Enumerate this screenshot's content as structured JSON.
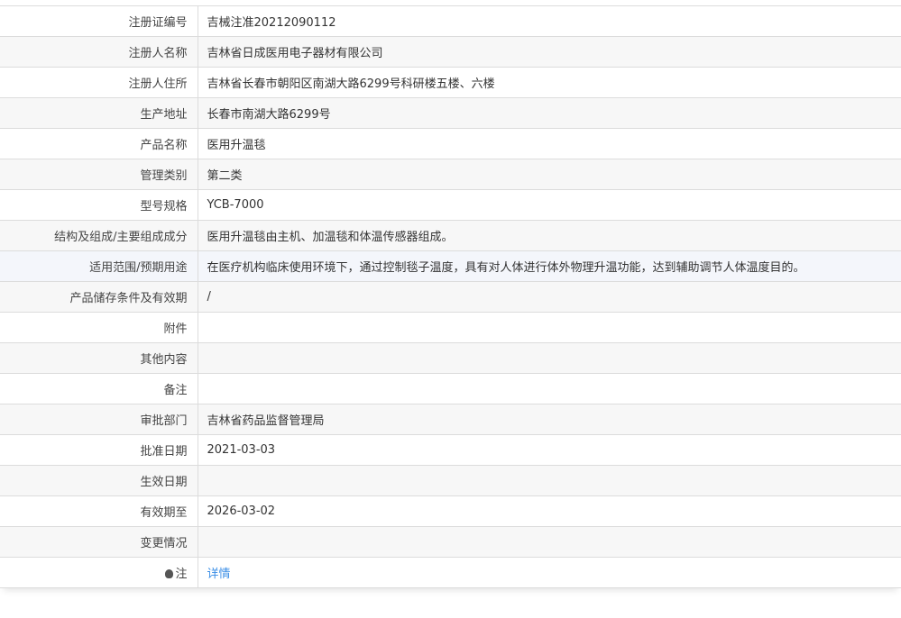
{
  "rows": [
    {
      "label": "注册证编号",
      "value": "吉械注准20212090112"
    },
    {
      "label": "注册人名称",
      "value": "吉林省日成医用电子器材有限公司"
    },
    {
      "label": "注册人住所",
      "value": "吉林省长春市朝阳区南湖大路6299号科研楼五楼、六楼"
    },
    {
      "label": "生产地址",
      "value": "长春市南湖大路6299号"
    },
    {
      "label": "产品名称",
      "value": "医用升温毯"
    },
    {
      "label": "管理类别",
      "value": "第二类"
    },
    {
      "label": "型号规格",
      "value": "YCB-7000"
    },
    {
      "label": "结构及组成/主要组成成分",
      "value": "医用升温毯由主机、加温毯和体温传感器组成。"
    },
    {
      "label": "适用范围/预期用途",
      "value": "在医疗机构临床使用环境下，通过控制毯子温度，具有对人体进行体外物理升温功能，达到辅助调节人体温度目的。"
    },
    {
      "label": "产品储存条件及有效期",
      "value": "/"
    },
    {
      "label": "附件",
      "value": ""
    },
    {
      "label": "其他内容",
      "value": ""
    },
    {
      "label": "备注",
      "value": ""
    },
    {
      "label": "审批部门",
      "value": "吉林省药品监督管理局"
    },
    {
      "label": "批准日期",
      "value": "2021-03-03"
    },
    {
      "label": "生效日期",
      "value": ""
    },
    {
      "label": "有效期至",
      "value": "2026-03-02"
    },
    {
      "label": "变更情况",
      "value": ""
    }
  ],
  "note": {
    "label": "注",
    "icon": "lightbulb-icon",
    "link": "详情"
  }
}
